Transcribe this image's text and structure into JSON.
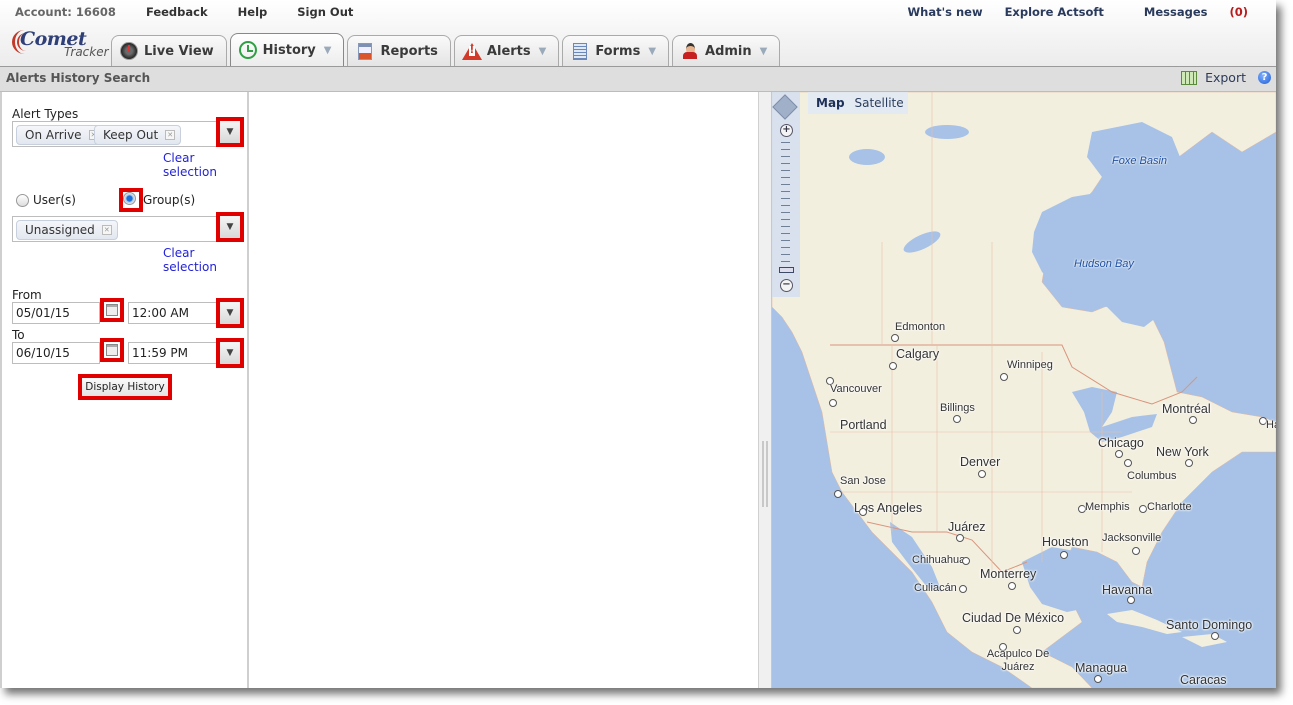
{
  "header": {
    "account": "Account: 16608",
    "links": [
      "Feedback",
      "Help",
      "Sign Out"
    ],
    "right_links": {
      "whats_new": "What's new",
      "explore": "Explore Actsoft",
      "messages": "Messages",
      "messages_count": "(0)"
    },
    "logo": {
      "brand": "Comet",
      "sub": "Tracker"
    }
  },
  "tabs": [
    {
      "label": "Live View",
      "icon": "gauge-icon",
      "dropdown": false,
      "active": false
    },
    {
      "label": "History",
      "icon": "clock-history-icon",
      "dropdown": true,
      "active": true
    },
    {
      "label": "Reports",
      "icon": "report-icon",
      "dropdown": false,
      "active": false
    },
    {
      "label": "Alerts",
      "icon": "warning-triangle-icon",
      "dropdown": true,
      "active": false
    },
    {
      "label": "Forms",
      "icon": "document-icon",
      "dropdown": true,
      "active": false
    },
    {
      "label": "Admin",
      "icon": "admin-user-icon",
      "dropdown": true,
      "active": false
    }
  ],
  "titlebar": {
    "title": "Alerts History Search",
    "export_label": "Export",
    "help": "?"
  },
  "search": {
    "alert_types_label": "Alert Types",
    "alert_types_selected": [
      "On Arrive",
      "Keep Out"
    ],
    "clear_selection": "Clear selection",
    "target_options": [
      {
        "label": "User(s)",
        "checked": false
      },
      {
        "label": "Group(s)",
        "checked": true
      }
    ],
    "groups_selected": [
      "Unassigned"
    ],
    "from_label": "From",
    "from_date": "05/01/15",
    "from_time": "12:00 AM",
    "to_label": "To",
    "to_date": "06/10/15",
    "to_time": "11:59 PM",
    "display_button": "Display History"
  },
  "map": {
    "type_options": {
      "map": "Map",
      "satellite": "Satellite"
    },
    "selected_type": "Map",
    "water_labels": [
      "Foxe Basin",
      "Hudson Bay"
    ],
    "cities": [
      "Edmonton",
      "Calgary",
      "Winnipeg",
      "Vancouver",
      "Billings",
      "Portland",
      "Denver",
      "San Jose",
      "Los Angeles",
      "Juárez",
      "Chihuahua",
      "Culiacán",
      "Monterrey",
      "Houston",
      "Ciudad De México",
      "Acapulco De Juárez",
      "Montréal",
      "Chicago",
      "New York",
      "Columbus",
      "Memphis",
      "Charlotte",
      "Jacksonville",
      "Havanna",
      "Santo Domingo",
      "Managua",
      "Caracas",
      "Hal"
    ]
  }
}
